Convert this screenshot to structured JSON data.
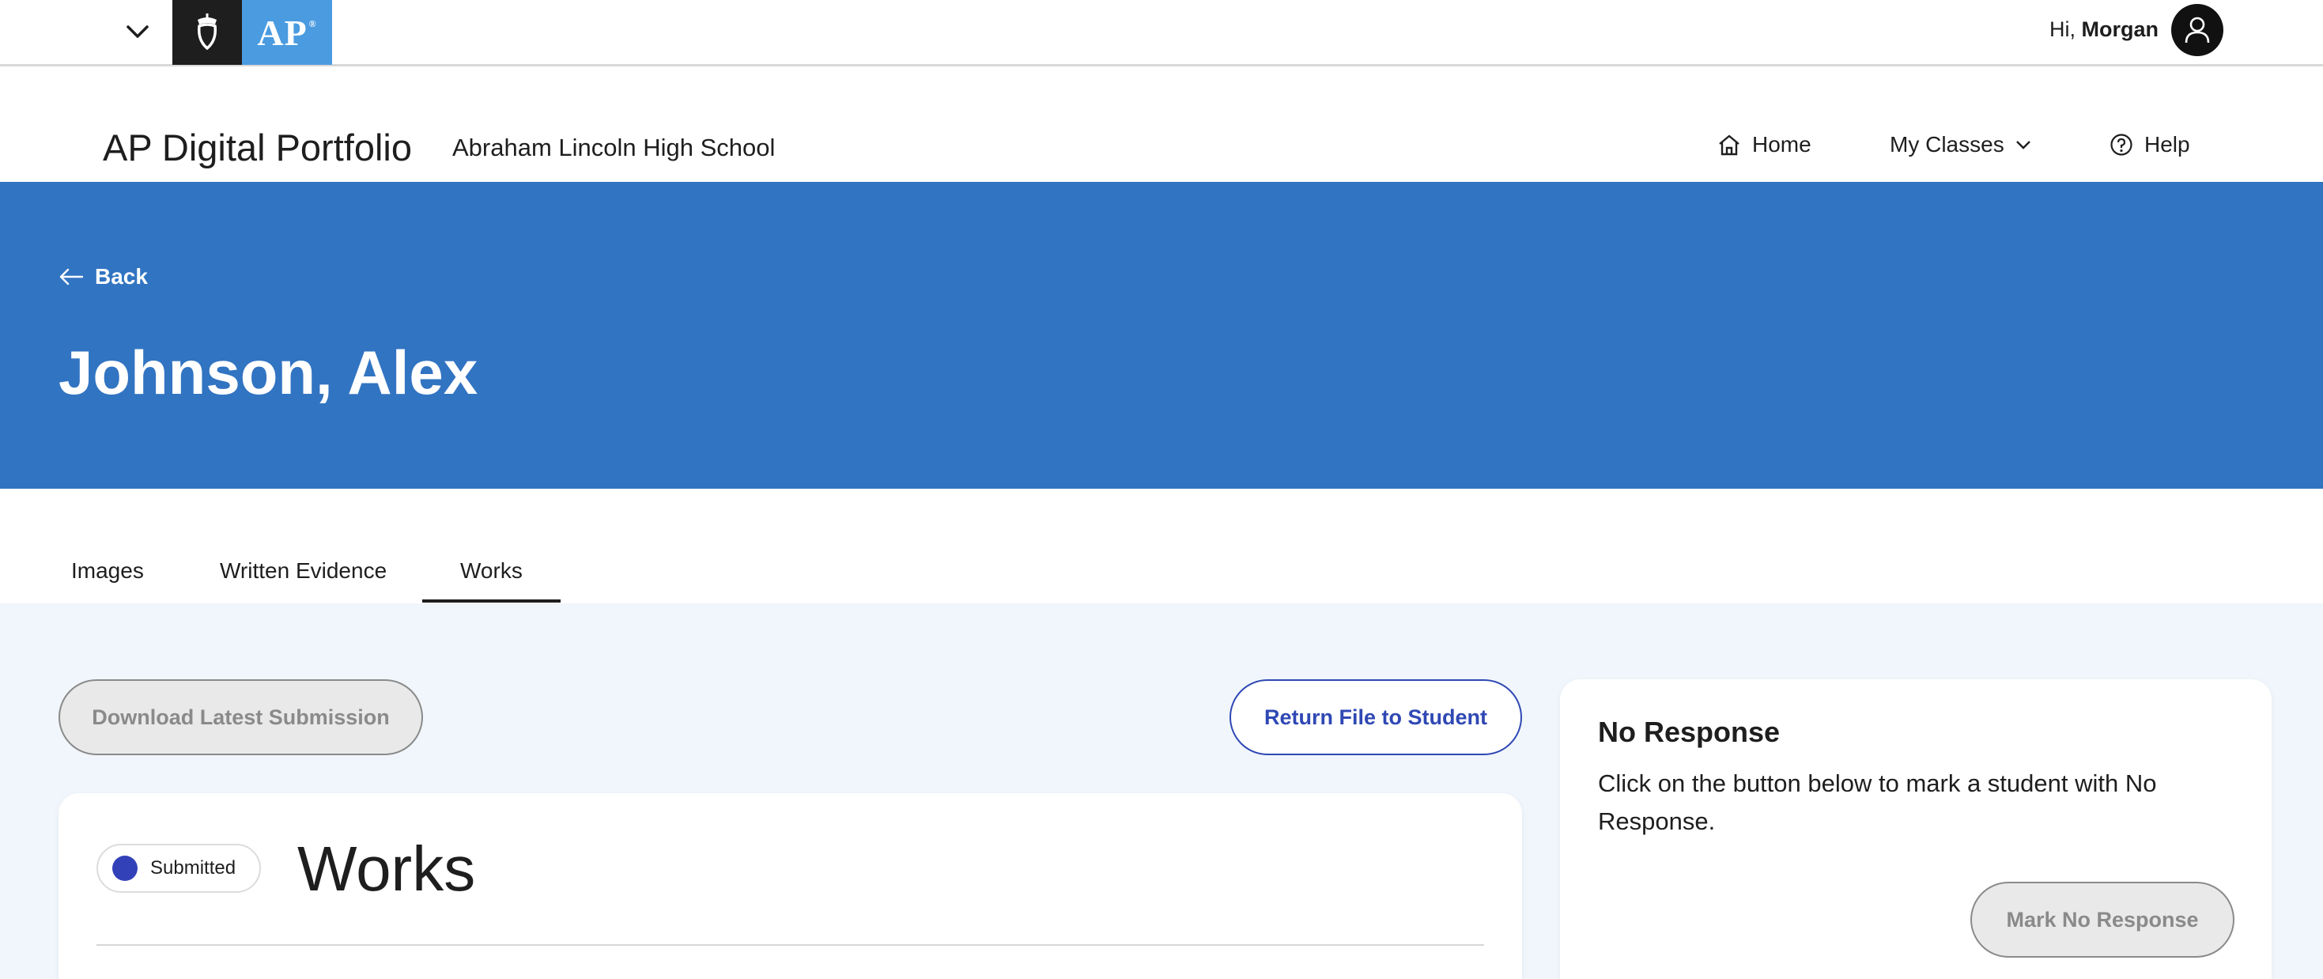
{
  "topbar": {
    "greeting_prefix": "Hi,",
    "user_name": "Morgan",
    "logo_text": "AP",
    "logo_mark": "®"
  },
  "product": {
    "title": "AP Digital Portfolio",
    "school": "Abraham Lincoln High School",
    "nav": {
      "home": "Home",
      "my_classes": "My Classes",
      "help": "Help"
    }
  },
  "hero": {
    "back_label": "Back",
    "student_name": "Johnson, Alex"
  },
  "tabs": {
    "items": [
      "Images",
      "Written Evidence",
      "Works"
    ],
    "active": "Works"
  },
  "actions": {
    "download_label": "Download Latest Submission",
    "return_label": "Return File to Student"
  },
  "works_card": {
    "status": "Submitted",
    "title": "Works"
  },
  "no_response": {
    "title": "No Response",
    "description": "Click on the button below to mark a student with No Response.",
    "button_label": "Mark No Response"
  },
  "colors": {
    "hero_blue": "#3174c2",
    "logo_blue": "#4a9be0",
    "accent_navy": "#2f48b4",
    "status_dot": "#3341b8",
    "content_bg": "#f0f6fb"
  }
}
